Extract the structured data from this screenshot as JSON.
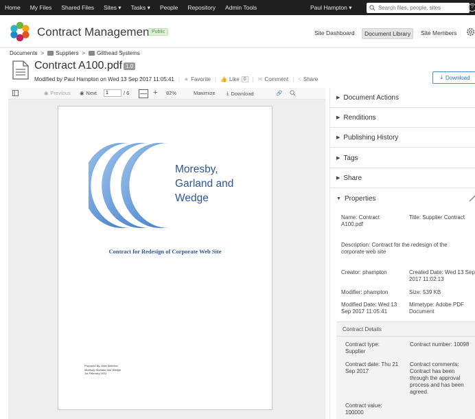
{
  "topnav": {
    "items": [
      "Home",
      "My Files",
      "Shared Files",
      "Sites ▾",
      "Tasks ▾",
      "People",
      "Repository",
      "Admin Tools"
    ],
    "user": "Paul Hampton ▾",
    "search_placeholder": "Search files, people, sites",
    "help": "?"
  },
  "site": {
    "title": "Contract Management",
    "visibility": "Public",
    "nav": [
      "Site Dashboard",
      "Document Library",
      "Site Members"
    ]
  },
  "breadcrumb": [
    "Documents",
    "Suppliers",
    "Gilthead Systems"
  ],
  "document": {
    "title": "Contract A100.pdf",
    "version": "1.0",
    "modified_text": "Modified by Paul Hampton on Wed 13 Sep 2017 11:05:41",
    "favorite": "Favorite",
    "like": "Like",
    "like_count": "0",
    "comment": "Comment",
    "share": "Share",
    "download": "Download"
  },
  "viewer": {
    "previous": "Previous",
    "next": "Next",
    "page": "1",
    "page_total": "/ 6",
    "zoom": "82%",
    "maximize": "Maximize",
    "download": "Download",
    "zoom_minus": "—",
    "zoom_plus": "+"
  },
  "pdf": {
    "company_lines": [
      "Moresby,",
      "Garland and",
      "Wedge"
    ],
    "heading": "Contract for Redesign of Corporate Web Site",
    "prepared_lines": [
      "Prepared By: Alice Beecher",
      "Moresby, Garland and Wedge",
      "1st February 2011"
    ]
  },
  "panel": {
    "sections": [
      "Document Actions",
      "Renditions",
      "Publishing History",
      "Tags",
      "Share",
      "Properties"
    ],
    "properties": {
      "name": "Name:  Contract A100.pdf",
      "title": "Title:  Supplier Contract",
      "description": "Description:  Contract for the redesign of the corporate web site",
      "creator": "Creator:  phampton",
      "created_date": "Created Date:  Wed 13 Sep 2017 11:02:13",
      "modifier": "Modifier:  phampton",
      "size": "Size:  539 KB",
      "modified_date": "Modified Date:  Wed 13 Sep 2017 11:05:41",
      "mimetype": "Mimetype:  Adobe PDF Document"
    },
    "contract_details": {
      "title": "Contract Details",
      "type": "Contract type:  Supplier",
      "number": "Contract number:  10098",
      "date": "Contract date:  Thu 21 Sep 2017",
      "comments": "Contract comments:  Contract has been through the approval process and has been agreed.",
      "value": "Contract value:  100000"
    }
  },
  "colors": {
    "nav_bg": "#1f1f1f",
    "accent_blue": "#2f5597",
    "download_blue": "#2a70b8",
    "public_green": "#5a8f3a"
  }
}
